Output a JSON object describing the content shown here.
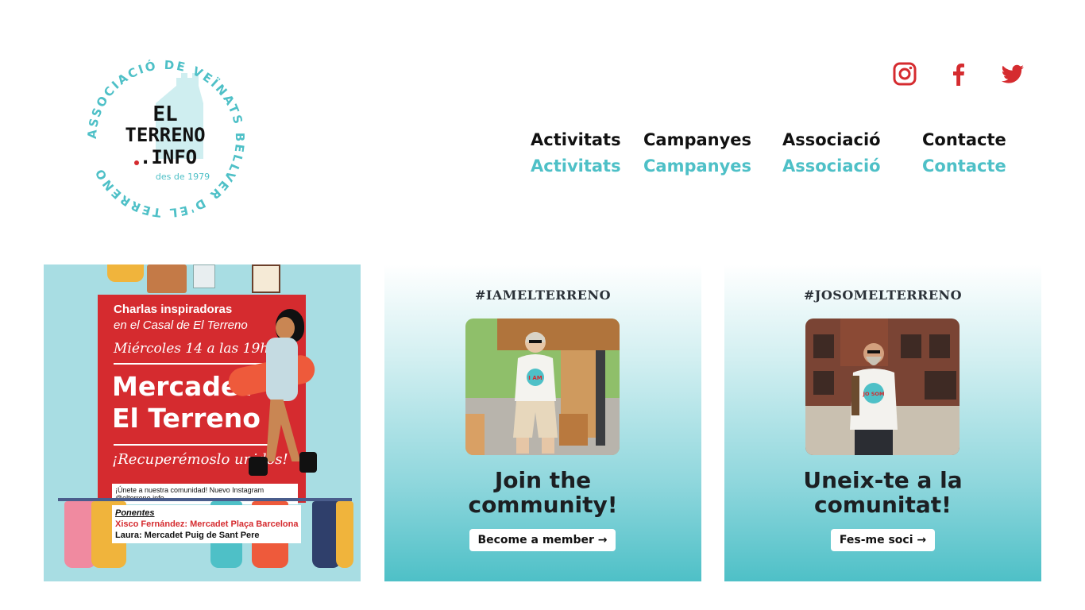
{
  "logo": {
    "ring_text": "ASSOCIACIÓ DE VEÏNATS BELLVER D'EL TERRENO",
    "line1": "EL",
    "line2": "TERRENO",
    "line3": ".INFO",
    "since": "des de 1979",
    "colors": {
      "accent": "#4ec0c7",
      "ink": "#111111",
      "red": "#d52b2f"
    }
  },
  "social": [
    {
      "icon": "instagram-icon"
    },
    {
      "icon": "facebook-icon"
    },
    {
      "icon": "twitter-icon"
    }
  ],
  "nav": [
    {
      "label": "Activitats",
      "hover_label": "Activitats"
    },
    {
      "label": "Campanyes",
      "hover_label": "Campanyes"
    },
    {
      "label": "Associació",
      "hover_label": "Associació"
    },
    {
      "label": "Contacte",
      "hover_label": "Contacte"
    }
  ],
  "poster": {
    "line1": "Charlas inspiradoras",
    "line2": "en el Casal de El Terreno",
    "date": "Miércoles 14 a las 19h",
    "title_line1": "Mercadet",
    "title_line2": "El Terreno",
    "slogan": "¡Recuperémoslo unidos!",
    "instagram": "¡Únete a nuestra comunidad! Nuevo Instagram @elterreno.info",
    "speakers_label": "Ponentes",
    "speaker1": "Xisco Fernández: Mercadet Plaça Barcelona",
    "speaker2": "Laura: Mercadet Puig de Sant Pere"
  },
  "cards": [
    {
      "hashtag": "#IAMELTERRENO",
      "headline_line1": "Join the",
      "headline_line2": "community!",
      "cta": "Become a member →",
      "shirt_text": "I AM"
    },
    {
      "hashtag": "#JOSOMELTERRENO",
      "headline_line1": "Uneix-te a la",
      "headline_line2": "comunitat!",
      "cta": "Fes-me soci →",
      "shirt_text": "JO SOM"
    }
  ],
  "colors": {
    "teal": "#4ec0c7",
    "red": "#d52b2f",
    "dark": "#1c1f22"
  }
}
